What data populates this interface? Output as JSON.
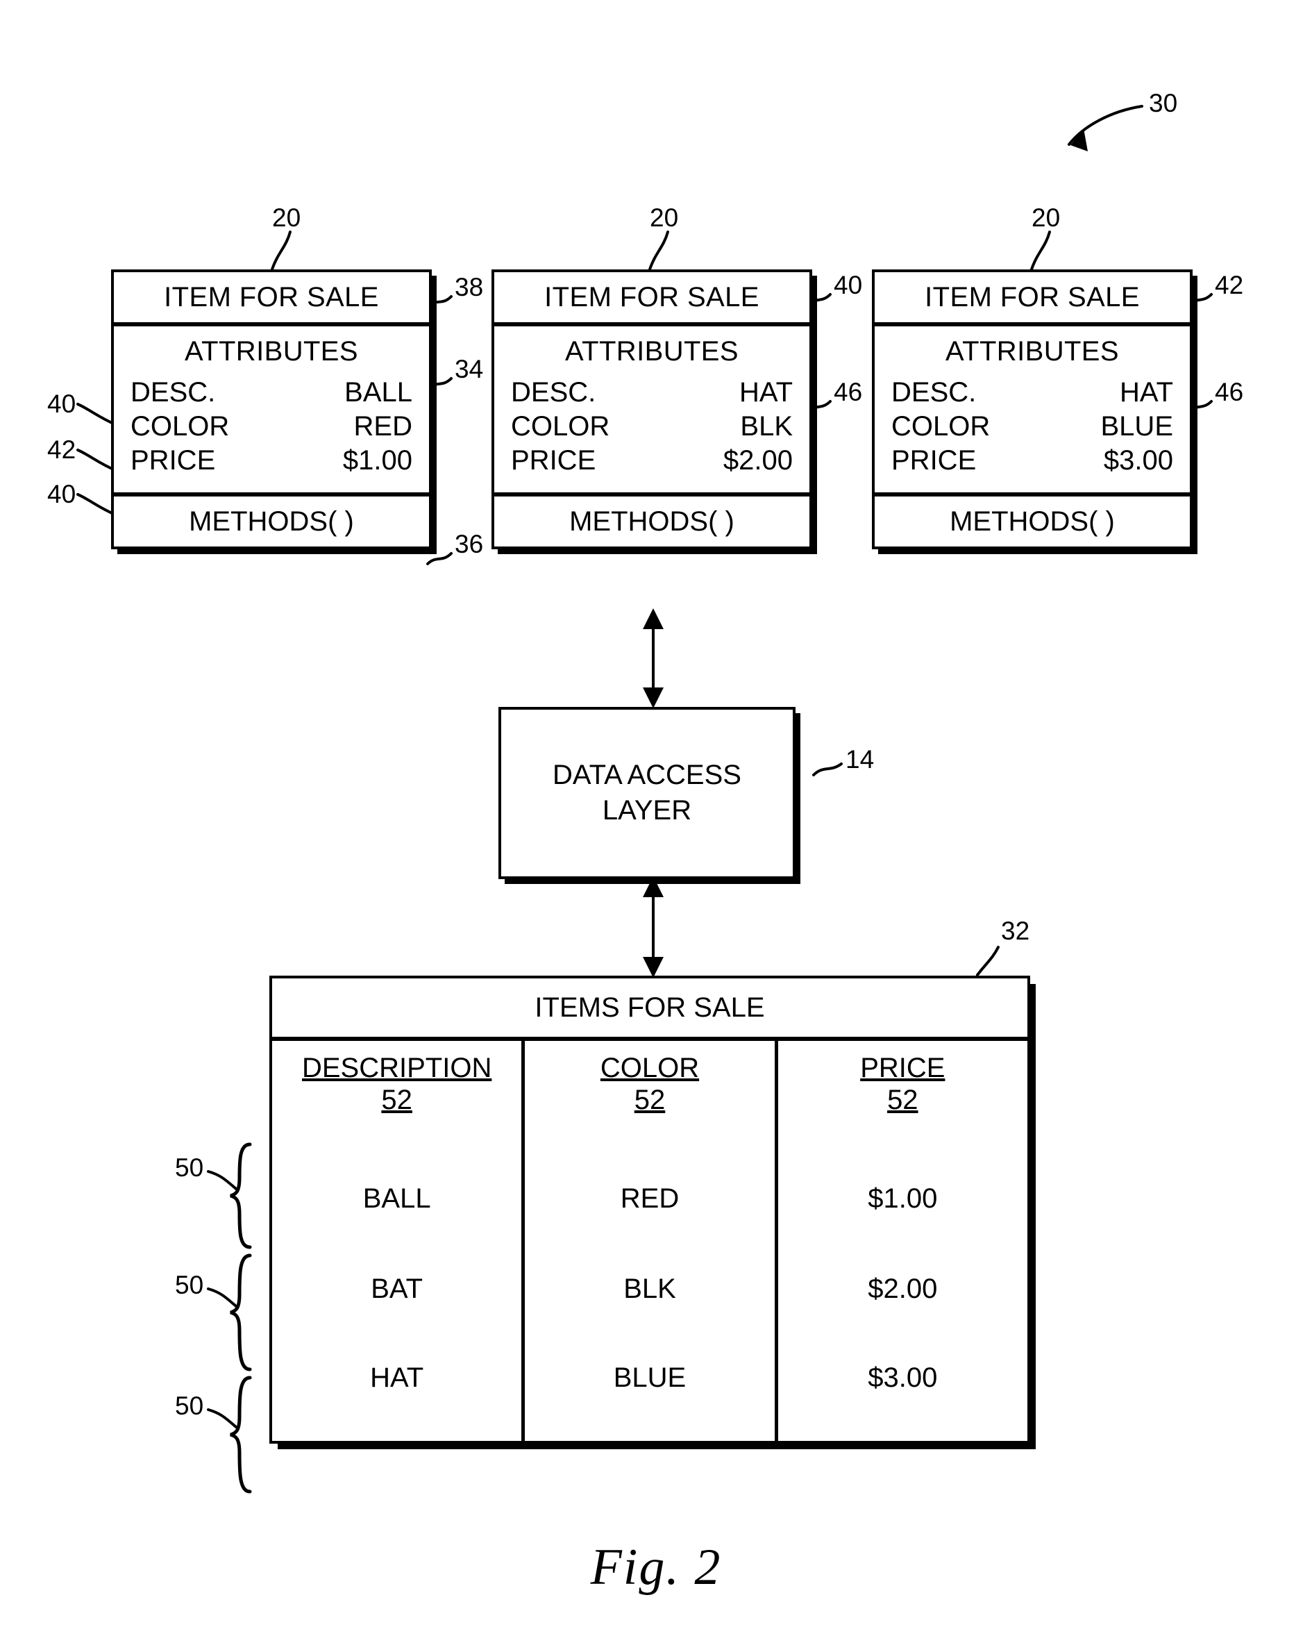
{
  "figure": {
    "caption": "Fig. 2",
    "overall_ref": "30"
  },
  "class_boxes": [
    {
      "top_ref": "20",
      "title": "ITEM FOR SALE",
      "attributes_header": "ATTRIBUTES",
      "rows": [
        {
          "name": "DESC.",
          "value": "BALL"
        },
        {
          "name": "COLOR",
          "value": "RED"
        },
        {
          "name": "PRICE",
          "value": "$1.00"
        }
      ],
      "methods": "METHODS( )",
      "left_refs": [
        "40",
        "42",
        "40"
      ],
      "right_refs": [
        "38",
        "34",
        "36"
      ]
    },
    {
      "top_ref": "20",
      "title": "ITEM FOR SALE",
      "attributes_header": "ATTRIBUTES",
      "rows": [
        {
          "name": "DESC.",
          "value": "HAT"
        },
        {
          "name": "COLOR",
          "value": "BLK"
        },
        {
          "name": "PRICE",
          "value": "$2.00"
        }
      ],
      "methods": "METHODS( )",
      "left_refs": [],
      "right_refs": [
        "40",
        "46"
      ]
    },
    {
      "top_ref": "20",
      "title": "ITEM FOR SALE",
      "attributes_header": "ATTRIBUTES",
      "rows": [
        {
          "name": "DESC.",
          "value": "HAT"
        },
        {
          "name": "COLOR",
          "value": "BLUE"
        },
        {
          "name": "PRICE",
          "value": "$3.00"
        }
      ],
      "methods": "METHODS( )",
      "left_refs": [],
      "right_refs": [
        "42",
        "46"
      ]
    }
  ],
  "data_access_layer": {
    "label_line1": "DATA ACCESS",
    "label_line2": "LAYER",
    "ref": "14"
  },
  "table": {
    "ref": "32",
    "title": "ITEMS FOR SALE",
    "columns": [
      {
        "header": "DESCRIPTION",
        "sub_ref": "52"
      },
      {
        "header": "COLOR",
        "sub_ref": "52"
      },
      {
        "header": "PRICE",
        "sub_ref": "52"
      }
    ],
    "rows": [
      {
        "ref": "50",
        "cells": [
          "BALL",
          "RED",
          "$1.00"
        ]
      },
      {
        "ref": "50",
        "cells": [
          "BAT",
          "BLK",
          "$2.00"
        ]
      },
      {
        "ref": "50",
        "cells": [
          "HAT",
          "BLUE",
          "$3.00"
        ]
      }
    ]
  },
  "icons": {
    "leader_line": "leader-line",
    "double_arrow": "double-headed-arrow",
    "brace": "curly-brace",
    "callout_arrow": "callout-arrow"
  }
}
